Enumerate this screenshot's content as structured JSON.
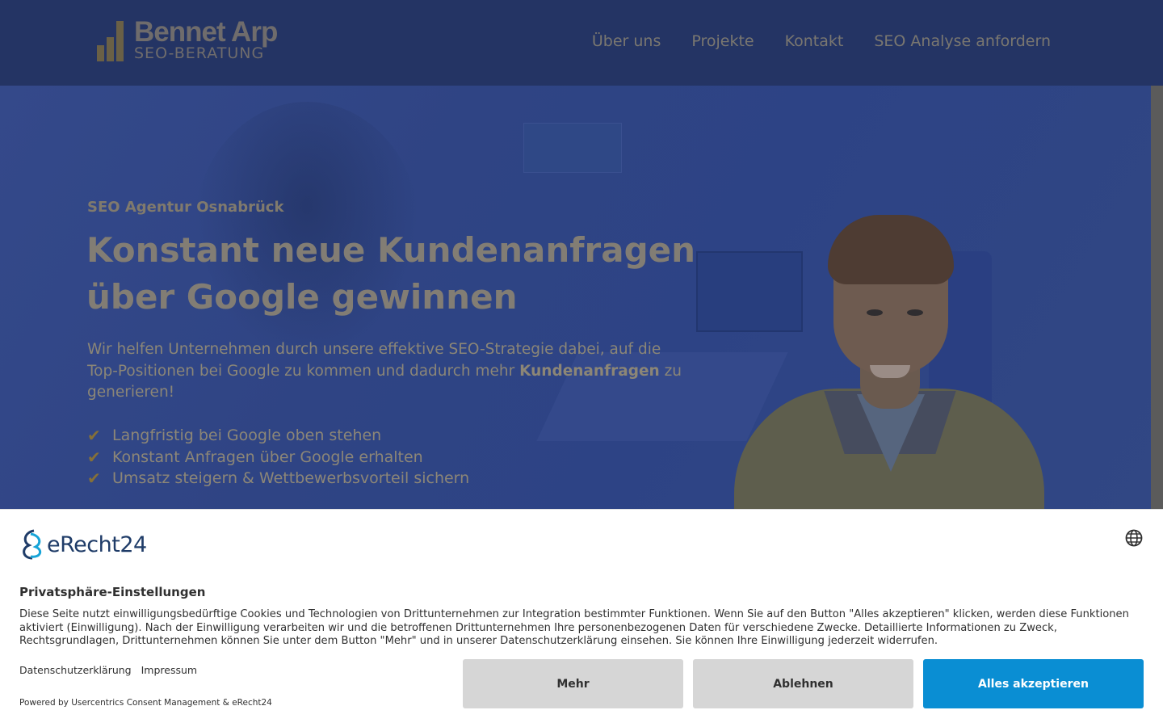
{
  "header": {
    "logo_name": "Bennet Arp",
    "logo_sub": "SEO-BERATUNG",
    "nav": [
      "Über uns",
      "Projekte",
      "Kontakt",
      "SEO Analyse anfordern"
    ]
  },
  "hero": {
    "kicker": "SEO Agentur Osnabrück",
    "headline_line1": "Konstant neue Kundenanfragen",
    "headline_line2": "über Google gewinnen",
    "lead_text": "Wir helfen Unternehmen durch unsere effektive SEO-Strategie dabei, auf die Top-Positionen bei Google zu kommen und dadurch mehr ",
    "lead_bold": "Kundenanfragen",
    "lead_end": " zu generieren!",
    "checklist": [
      "Langfristig bei Google oben stehen",
      "Konstant Anfragen über Google erhalten",
      "Umsatz steigern & Wettbewerbsvorteil sichern"
    ]
  },
  "consent": {
    "logo_text": "eRecht24",
    "title": "Privatsphäre-Einstellungen",
    "text": "Diese Seite nutzt einwilligungsbedürftige Cookies und Technologien von Drittunternehmen zur Integration bestimmter Funktionen. Wenn Sie auf den Button \"Alles akzeptieren\" klicken, werden diese Funktionen aktiviert (Einwilligung). Nach der Einwilligung verarbeiten wir und die betroffenen Drittunternehmen Ihre personenbezogenen Daten für verschiedene Zwecke. Detaillierte Informationen zu Zweck, Rechtsgrundlagen, Drittunternehmen können Sie unter dem Button \"Mehr\" und in unserer Datenschutzerklärung einsehen. Sie können Ihre Einwilligung jederzeit widerrufen.",
    "link_privacy": "Datenschutzerklärung",
    "link_imprint": "Impressum",
    "powered_by": "Powered by Usercentrics Consent Management & eRecht24",
    "btn_more": "Mehr",
    "btn_deny": "Ablehnen",
    "btn_accept": "Alles akzeptieren"
  },
  "colors": {
    "header_bg": "#243464",
    "hero_overlay": "#2d4385",
    "accent_gold": "#857038",
    "accept_blue": "#0a8ed3",
    "secondary_button": "#d6d6d6"
  },
  "icons": [
    "logo-bars-icon",
    "check-icon",
    "globe-icon",
    "erecht24-logo-icon"
  ]
}
